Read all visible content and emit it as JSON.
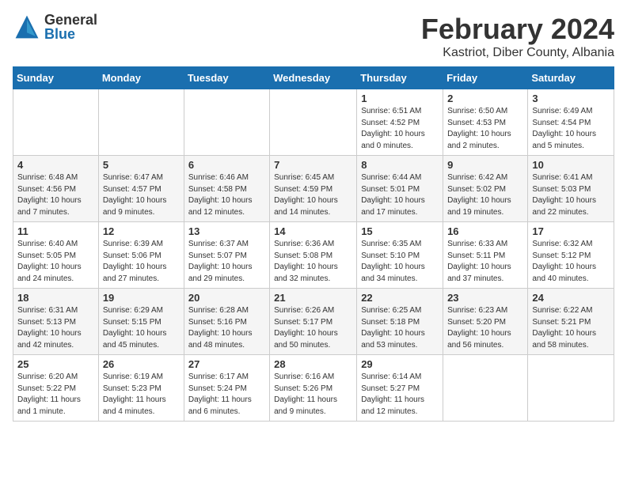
{
  "header": {
    "logo_general": "General",
    "logo_blue": "Blue",
    "month_title": "February 2024",
    "location": "Kastriot, Diber County, Albania"
  },
  "weekdays": [
    "Sunday",
    "Monday",
    "Tuesday",
    "Wednesday",
    "Thursday",
    "Friday",
    "Saturday"
  ],
  "weeks": [
    [
      {
        "day": "",
        "info": ""
      },
      {
        "day": "",
        "info": ""
      },
      {
        "day": "",
        "info": ""
      },
      {
        "day": "",
        "info": ""
      },
      {
        "day": "1",
        "info": "Sunrise: 6:51 AM\nSunset: 4:52 PM\nDaylight: 10 hours\nand 0 minutes."
      },
      {
        "day": "2",
        "info": "Sunrise: 6:50 AM\nSunset: 4:53 PM\nDaylight: 10 hours\nand 2 minutes."
      },
      {
        "day": "3",
        "info": "Sunrise: 6:49 AM\nSunset: 4:54 PM\nDaylight: 10 hours\nand 5 minutes."
      }
    ],
    [
      {
        "day": "4",
        "info": "Sunrise: 6:48 AM\nSunset: 4:56 PM\nDaylight: 10 hours\nand 7 minutes."
      },
      {
        "day": "5",
        "info": "Sunrise: 6:47 AM\nSunset: 4:57 PM\nDaylight: 10 hours\nand 9 minutes."
      },
      {
        "day": "6",
        "info": "Sunrise: 6:46 AM\nSunset: 4:58 PM\nDaylight: 10 hours\nand 12 minutes."
      },
      {
        "day": "7",
        "info": "Sunrise: 6:45 AM\nSunset: 4:59 PM\nDaylight: 10 hours\nand 14 minutes."
      },
      {
        "day": "8",
        "info": "Sunrise: 6:44 AM\nSunset: 5:01 PM\nDaylight: 10 hours\nand 17 minutes."
      },
      {
        "day": "9",
        "info": "Sunrise: 6:42 AM\nSunset: 5:02 PM\nDaylight: 10 hours\nand 19 minutes."
      },
      {
        "day": "10",
        "info": "Sunrise: 6:41 AM\nSunset: 5:03 PM\nDaylight: 10 hours\nand 22 minutes."
      }
    ],
    [
      {
        "day": "11",
        "info": "Sunrise: 6:40 AM\nSunset: 5:05 PM\nDaylight: 10 hours\nand 24 minutes."
      },
      {
        "day": "12",
        "info": "Sunrise: 6:39 AM\nSunset: 5:06 PM\nDaylight: 10 hours\nand 27 minutes."
      },
      {
        "day": "13",
        "info": "Sunrise: 6:37 AM\nSunset: 5:07 PM\nDaylight: 10 hours\nand 29 minutes."
      },
      {
        "day": "14",
        "info": "Sunrise: 6:36 AM\nSunset: 5:08 PM\nDaylight: 10 hours\nand 32 minutes."
      },
      {
        "day": "15",
        "info": "Sunrise: 6:35 AM\nSunset: 5:10 PM\nDaylight: 10 hours\nand 34 minutes."
      },
      {
        "day": "16",
        "info": "Sunrise: 6:33 AM\nSunset: 5:11 PM\nDaylight: 10 hours\nand 37 minutes."
      },
      {
        "day": "17",
        "info": "Sunrise: 6:32 AM\nSunset: 5:12 PM\nDaylight: 10 hours\nand 40 minutes."
      }
    ],
    [
      {
        "day": "18",
        "info": "Sunrise: 6:31 AM\nSunset: 5:13 PM\nDaylight: 10 hours\nand 42 minutes."
      },
      {
        "day": "19",
        "info": "Sunrise: 6:29 AM\nSunset: 5:15 PM\nDaylight: 10 hours\nand 45 minutes."
      },
      {
        "day": "20",
        "info": "Sunrise: 6:28 AM\nSunset: 5:16 PM\nDaylight: 10 hours\nand 48 minutes."
      },
      {
        "day": "21",
        "info": "Sunrise: 6:26 AM\nSunset: 5:17 PM\nDaylight: 10 hours\nand 50 minutes."
      },
      {
        "day": "22",
        "info": "Sunrise: 6:25 AM\nSunset: 5:18 PM\nDaylight: 10 hours\nand 53 minutes."
      },
      {
        "day": "23",
        "info": "Sunrise: 6:23 AM\nSunset: 5:20 PM\nDaylight: 10 hours\nand 56 minutes."
      },
      {
        "day": "24",
        "info": "Sunrise: 6:22 AM\nSunset: 5:21 PM\nDaylight: 10 hours\nand 58 minutes."
      }
    ],
    [
      {
        "day": "25",
        "info": "Sunrise: 6:20 AM\nSunset: 5:22 PM\nDaylight: 11 hours\nand 1 minute."
      },
      {
        "day": "26",
        "info": "Sunrise: 6:19 AM\nSunset: 5:23 PM\nDaylight: 11 hours\nand 4 minutes."
      },
      {
        "day": "27",
        "info": "Sunrise: 6:17 AM\nSunset: 5:24 PM\nDaylight: 11 hours\nand 6 minutes."
      },
      {
        "day": "28",
        "info": "Sunrise: 6:16 AM\nSunset: 5:26 PM\nDaylight: 11 hours\nand 9 minutes."
      },
      {
        "day": "29",
        "info": "Sunrise: 6:14 AM\nSunset: 5:27 PM\nDaylight: 11 hours\nand 12 minutes."
      },
      {
        "day": "",
        "info": ""
      },
      {
        "day": "",
        "info": ""
      }
    ]
  ]
}
